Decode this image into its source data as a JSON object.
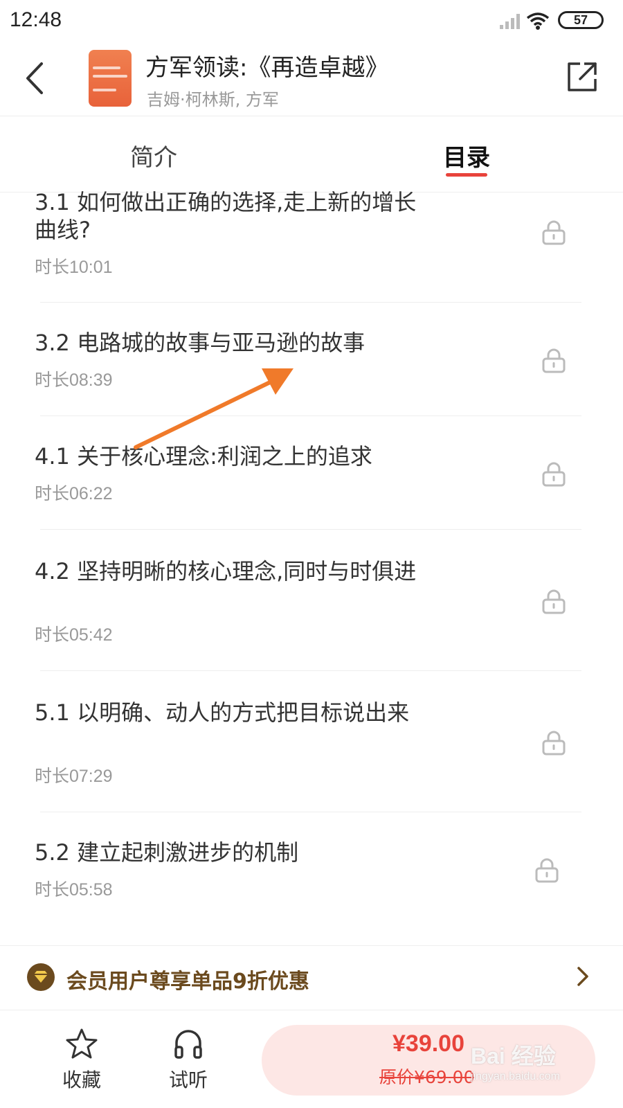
{
  "status_bar": {
    "time": "12:48",
    "battery": "57"
  },
  "header": {
    "title": "方军领读:《再造卓越》",
    "author": "吉姆·柯林斯, 方军"
  },
  "tabs": [
    {
      "label": "简介",
      "active": false
    },
    {
      "label": "目录",
      "active": true
    }
  ],
  "chapters": [
    {
      "title": "3.1 如何做出正确的选择,走上新的增长曲线?",
      "duration": "时长10:01",
      "locked": true
    },
    {
      "title": "3.2 电路城的故事与亚马逊的故事",
      "duration": "时长08:39",
      "locked": true
    },
    {
      "title": "4.1 关于核心理念:利润之上的追求",
      "duration": "时长06:22",
      "locked": true
    },
    {
      "title": "4.2 坚持明晰的核心理念,同时与时俱进",
      "duration": "时长05:42",
      "locked": true
    },
    {
      "title": "5.1 以明确、动人的方式把目标说出来",
      "duration": "时长07:29",
      "locked": true
    },
    {
      "title": "5.2 建立起刺激进步的机制",
      "duration": "时长05:58",
      "locked": true
    }
  ],
  "member_bar": {
    "text": "会员用户尊享单品9折优惠"
  },
  "bottom_bar": {
    "favorite_label": "收藏",
    "listen_label": "试听",
    "price": "¥39.00",
    "original_price": "原价¥69.00"
  },
  "watermark": {
    "main": "Bai 经验",
    "sub": "jingyan.baidu.com"
  },
  "colors": {
    "accent": "#e8433b",
    "member_gold": "#6b4a1e",
    "annotation_arrow": "#f07a2a"
  }
}
